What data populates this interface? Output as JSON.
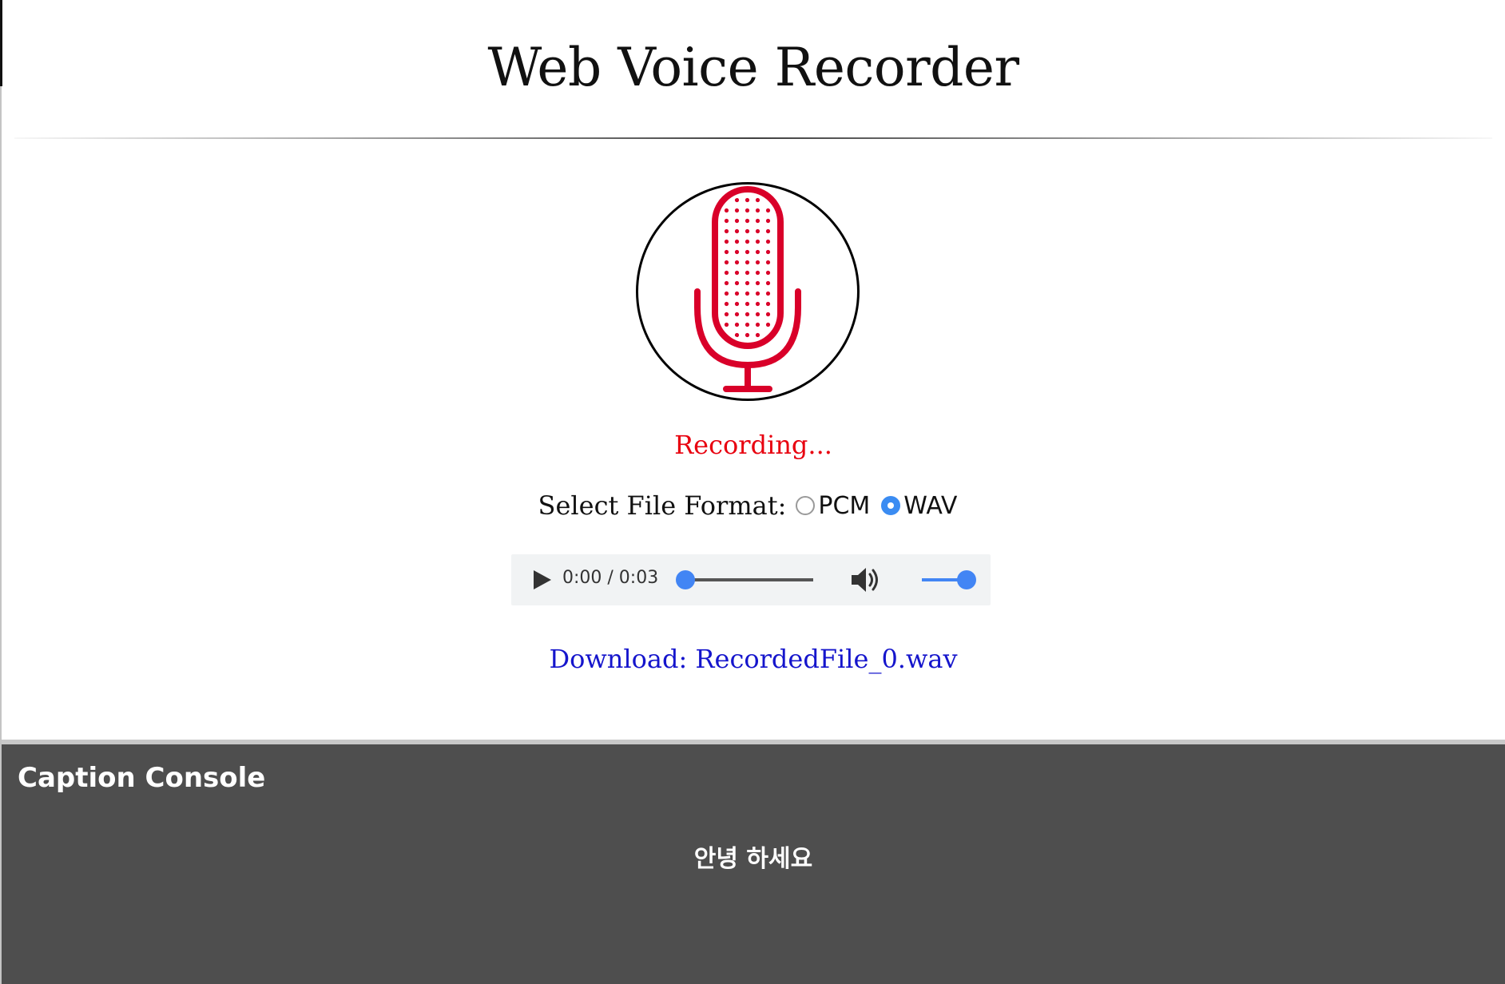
{
  "header": {
    "title": "Web Voice Recorder"
  },
  "recorder": {
    "mic_icon": "microphone-icon",
    "status": "Recording...",
    "status_color": "#e8000f",
    "mic_color": "#d90029"
  },
  "format": {
    "label": "Select File Format:",
    "options": [
      {
        "label": "PCM",
        "selected": false
      },
      {
        "label": "WAV",
        "selected": true
      }
    ]
  },
  "audio_player": {
    "time": "0:00 / 0:03",
    "play_icon": "play-icon",
    "volume_icon": "volume-icon",
    "seek_fraction": 0.0,
    "volume_fraction": 1.0,
    "accent_color": "#4285f4"
  },
  "download": {
    "label": "Download: RecordedFile_0.wav",
    "color": "#1515cc"
  },
  "caption_console": {
    "title": "Caption Console",
    "text": "안녕 하세요"
  }
}
